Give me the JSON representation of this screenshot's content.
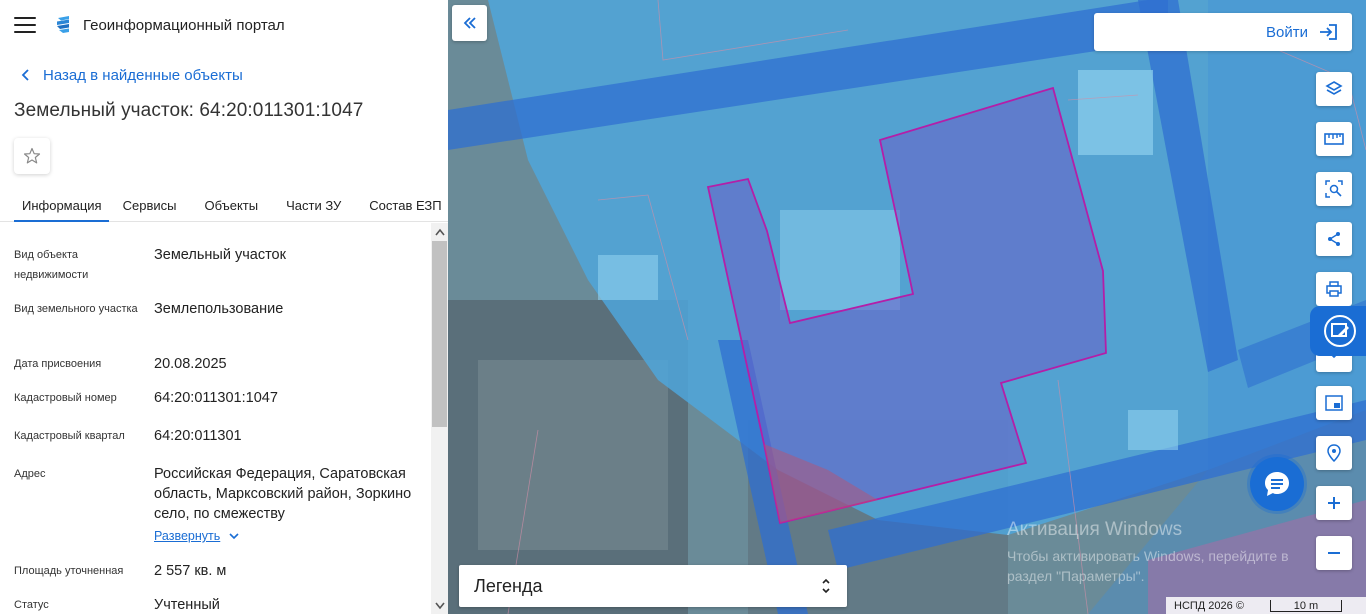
{
  "header": {
    "menu_icon": "hamburger-menu-icon",
    "logo_icon": "portal-logo-icon",
    "title": "Геоинформационный портал"
  },
  "back_link": {
    "icon": "chevron-left-icon",
    "label": "Назад в найденные объекты"
  },
  "object_title": "Земельный участок: 64:20:011301:1047",
  "favorite_icon": "star-outline-icon",
  "tabs": [
    {
      "label": "Информация",
      "active": true
    },
    {
      "label": "Сервисы",
      "active": false
    },
    {
      "label": "Объекты",
      "active": false
    },
    {
      "label": "Части ЗУ",
      "active": false
    },
    {
      "label": "Состав ЕЗП",
      "active": false
    }
  ],
  "info": [
    {
      "label": "Вид объекта недвижимости",
      "value": "Земельный участок"
    },
    {
      "label": "Вид земельного участка",
      "value": "Землепользование"
    },
    {
      "label": "Дата присвоения",
      "value": "20.08.2025"
    },
    {
      "label": "Кадастровый номер",
      "value": "64:20:011301:1047"
    },
    {
      "label": "Кадастровый квартал",
      "value": "64:20:011301"
    },
    {
      "label": "Адрес",
      "value": "Российская Федерация, Саратовская область, Марксовский район, Зоркино село, по смежеству"
    },
    {
      "label": "Площадь уточненная",
      "value": "2 557 кв. м"
    },
    {
      "label": "Статус",
      "value": "Учтенный"
    }
  ],
  "expand_label": "Развернуть",
  "map": {
    "collapse_icon": "double-chevron-left-icon",
    "login_label": "Войти",
    "login_icon": "login-arrow-icon",
    "tools": [
      "layers-icon",
      "ruler-icon",
      "area-search-icon",
      "share-icon",
      "print-icon",
      "chevron-down-icon",
      "picture-in-picture-icon",
      "location-icon",
      "zoom-in-icon",
      "zoom-out-icon"
    ],
    "feedback_icon": "feedback-edit-icon",
    "chat_icon": "chat-bubble-icon",
    "legend_label": "Легенда",
    "legend_icon": "expand-updown-icon",
    "watermark_title": "Активация Windows",
    "watermark_text": "Чтобы активировать Windows, перейдите в раздел \"Параметры\".",
    "copyright": "НСПД 2026 ©",
    "scale_label": "10 m",
    "colors": {
      "accent": "#1a6dd4",
      "parcel_outline": "#b41ea8",
      "zone_blue": "#3f8fd8"
    }
  }
}
